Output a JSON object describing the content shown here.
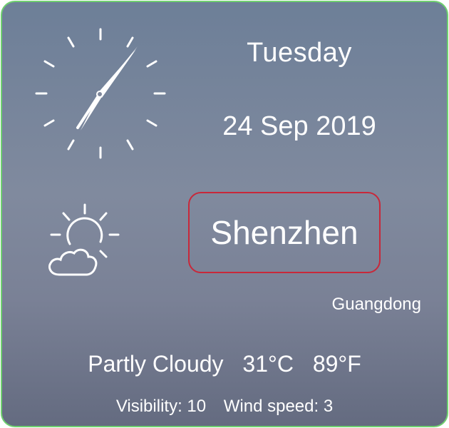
{
  "clock": {
    "time_display": "analog-clock-icon"
  },
  "day": "Tuesday",
  "date": "24 Sep 2019",
  "weather_icon": "partly-cloudy-icon",
  "city": "Shenzhen",
  "province": "Guangdong",
  "condition": {
    "summary": "Partly Cloudy",
    "temp_c": "31°C",
    "temp_f": "89°F"
  },
  "details": {
    "visibility": "Visibility: 10",
    "wind_speed": "Wind speed: 3"
  },
  "colors": {
    "city_border": "#c8283a",
    "widget_border": "#6fd06f"
  }
}
